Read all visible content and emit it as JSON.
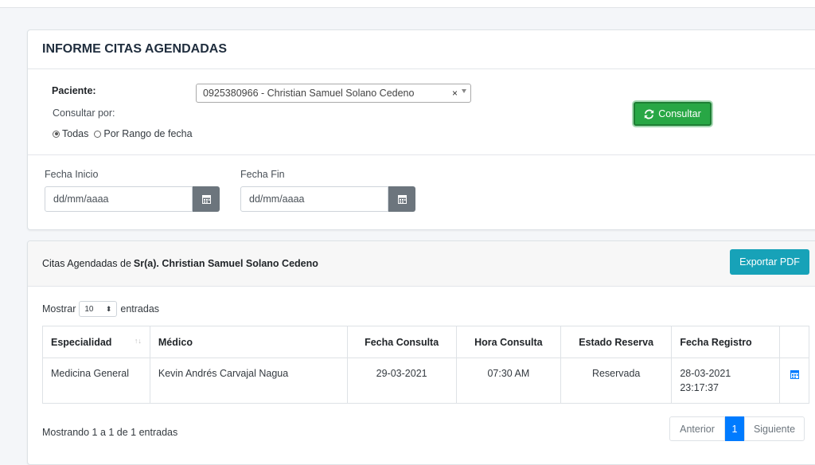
{
  "card1": {
    "title": "INFORME CITAS AGENDADAS",
    "paciente_label": "Paciente:",
    "paciente_value": "0925380966 - Christian Samuel Solano Cedeno",
    "clear_glyph": "×",
    "consultar_por_label": "Consultar por:",
    "radio_todas": "Todas",
    "radio_rango": "Por Rango de fecha",
    "consultar_button": "Consultar",
    "fecha_inicio_label": "Fecha Inicio",
    "fecha_fin_label": "Fecha Fin",
    "fecha_inicio_placeholder": "dd/mm/aaaa",
    "fecha_fin_placeholder": "dd/mm/aaaa"
  },
  "card2": {
    "header_prefix": "Citas Agendadas de ",
    "header_name": "Sr(a). Christian Samuel Solano Cedeno",
    "export_button": "Exportar PDF",
    "mostrar_label": "Mostrar",
    "page_length": "10",
    "entradas_label": "entradas",
    "columns": [
      "Especialidad",
      "Médico",
      "Fecha Consulta",
      "Hora Consulta",
      "Estado Reserva",
      "Fecha Registro"
    ],
    "rows": [
      {
        "especialidad": "Medicina General",
        "medico": "Kevin Andrés Carvajal Nagua",
        "fecha_consulta": "29-03-2021",
        "hora_consulta": "07:30 AM",
        "estado": "Reservada",
        "fecha_registro_date": "28-03-2021",
        "fecha_registro_time": "23:17:37"
      }
    ],
    "info_text": "Mostrando 1 a 1 de 1 entradas",
    "pager": {
      "prev": "Anterior",
      "current": "1",
      "next": "Siguiente"
    }
  },
  "colors": {
    "consultar": "#28a745",
    "export": "#17a2b8",
    "active_page": "#007bff",
    "date_button": "#6c757d"
  },
  "icons": {
    "consultar": "sync-icon",
    "date": "calendar-icon",
    "row_action": "calendar-icon"
  }
}
